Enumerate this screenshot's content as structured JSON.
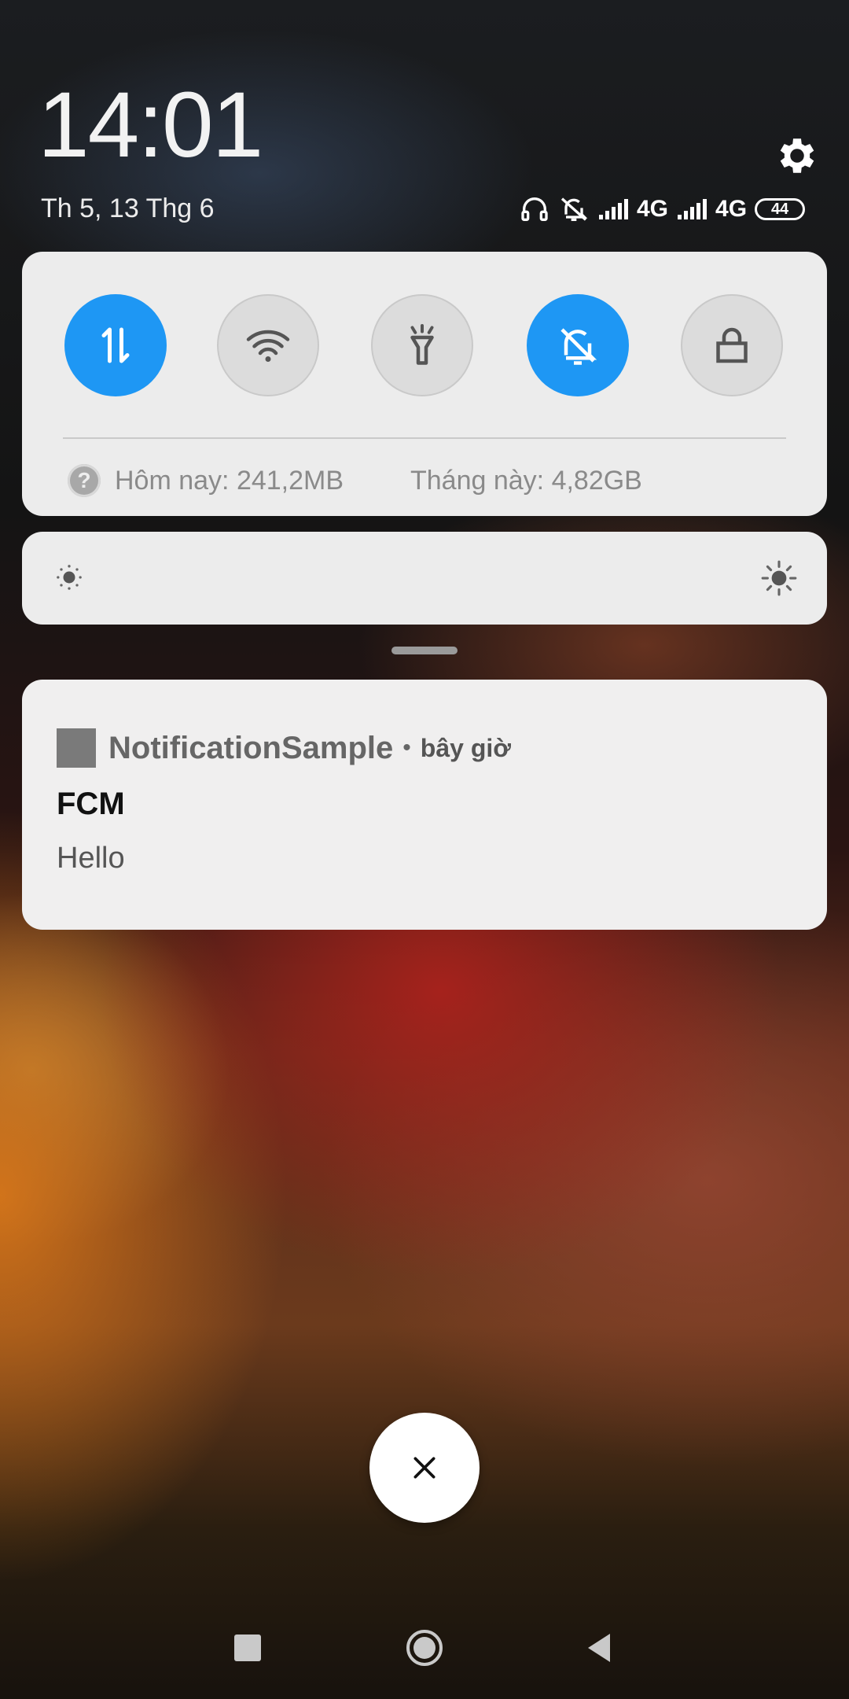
{
  "status_bar": {
    "time": "14:01",
    "date": "Th 5, 13 Thg 6",
    "network_1": "4G",
    "network_2": "4G",
    "battery": "44",
    "icons": [
      "headphones-icon",
      "bell-muted-icon",
      "signal-icon",
      "settings-gear-icon"
    ]
  },
  "quick_settings": {
    "tiles": [
      {
        "name": "mobile-data",
        "state": "on",
        "icon": "data-arrows-icon"
      },
      {
        "name": "wifi",
        "state": "off",
        "icon": "wifi-icon"
      },
      {
        "name": "flashlight",
        "state": "off",
        "icon": "flashlight-icon"
      },
      {
        "name": "silent",
        "state": "on",
        "icon": "bell-off-icon"
      },
      {
        "name": "lock-screen",
        "state": "off",
        "icon": "lock-icon"
      }
    ],
    "usage_today": "Hôm nay: 241,2MB",
    "usage_month": "Tháng này: 4,82GB"
  },
  "brightness": {
    "level": 0.0,
    "icons": [
      "brightness-low-icon",
      "brightness-high-icon"
    ]
  },
  "notification": {
    "app_name": "NotificationSample",
    "separator": "•",
    "time": "bây giờ",
    "title": "FCM",
    "body": "Hello"
  },
  "colors": {
    "accent": "#1e97f4",
    "panel": "#ececec"
  },
  "nav_bar": {
    "icons": [
      "recents-square-icon",
      "home-circle-icon",
      "back-triangle-icon"
    ]
  }
}
